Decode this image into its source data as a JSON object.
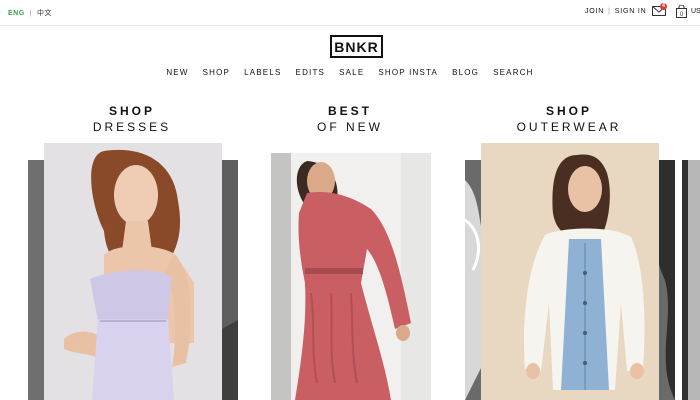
{
  "topbar": {
    "lang_active": "ENG",
    "lang_sep": "|",
    "lang_other": "中文",
    "join": "JOIN",
    "account_sep": "|",
    "sign_in": "SIGN IN",
    "mail_badge": "4",
    "bag_count": "0",
    "currency": "US"
  },
  "logo": {
    "text": "BNKR"
  },
  "nav": {
    "items": [
      "NEW",
      "SHOP",
      "LABELS",
      "EDITS",
      "SALE",
      "SHOP INSTA",
      "BLOG",
      "SEARCH"
    ]
  },
  "sections": [
    {
      "line1": "SHOP",
      "line2": "DRESSES"
    },
    {
      "line1": "BEST",
      "line2": "OF NEW"
    },
    {
      "line1": "SHOP",
      "line2": "OUTERWEAR"
    }
  ],
  "colors": {
    "accent_green": "#3fa34d",
    "badge_red": "#e53935"
  },
  "icons": [
    "mail-icon",
    "shopping-bag-icon"
  ]
}
